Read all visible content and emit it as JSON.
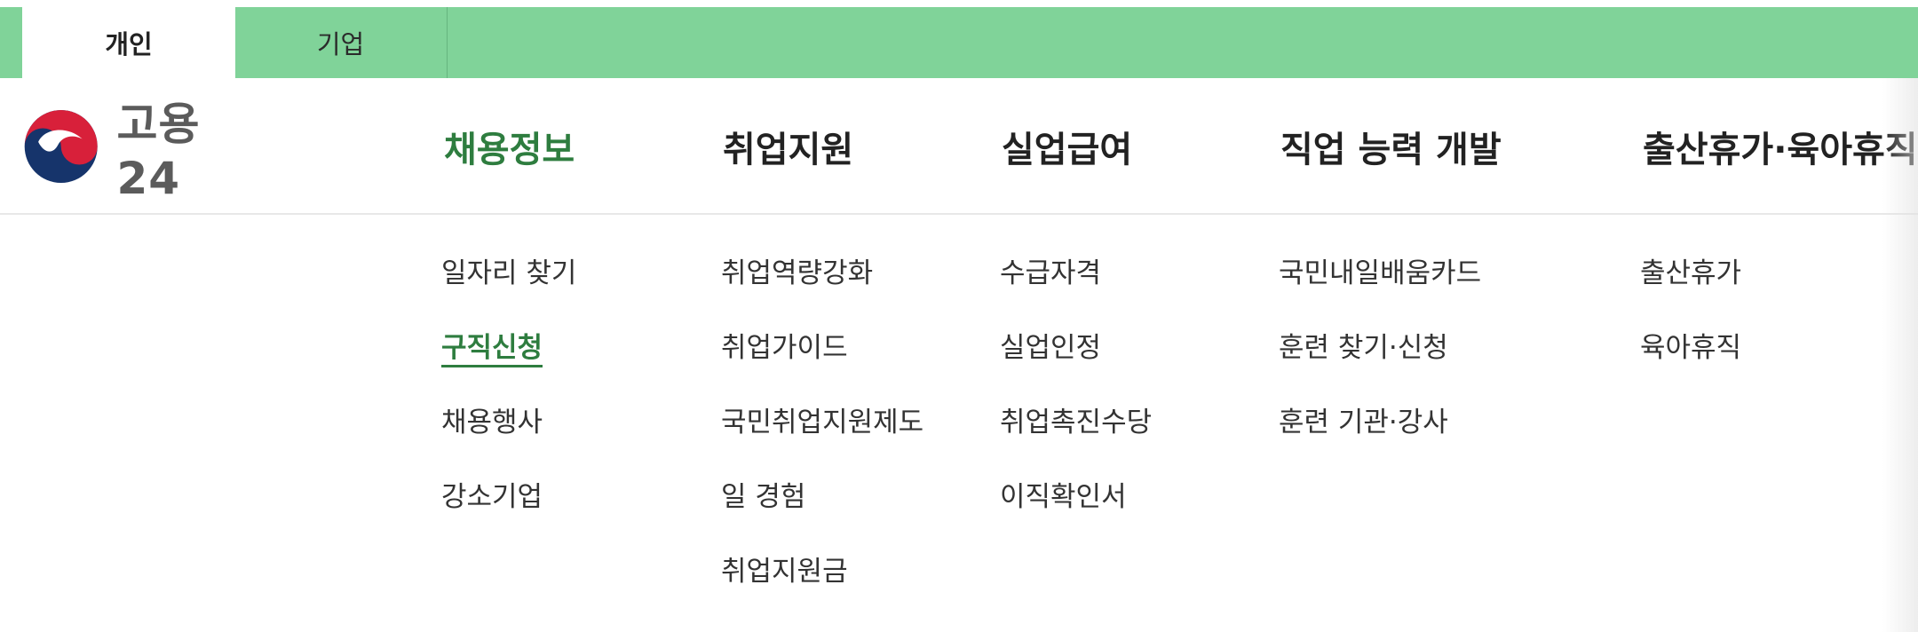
{
  "audience_tabs": [
    {
      "label": "개인",
      "active": true
    },
    {
      "label": "기업",
      "active": false
    }
  ],
  "logo": {
    "text": "고용24",
    "icon": "korea-government-emblem-icon"
  },
  "gnb": [
    {
      "label": "채용정보",
      "active": true
    },
    {
      "label": "취업지원",
      "active": false
    },
    {
      "label": "실업급여",
      "active": false
    },
    {
      "label": "직업 능력 개발",
      "active": false
    },
    {
      "label": "출산휴가·육아휴직",
      "active": false
    }
  ],
  "submenu": [
    {
      "items": [
        "일자리 찾기",
        "구직신청",
        "채용행사",
        "강소기업"
      ],
      "active_index": 1
    },
    {
      "items": [
        "취업역량강화",
        "취업가이드",
        "국민취업지원제도",
        "일 경험",
        "취업지원금"
      ]
    },
    {
      "items": [
        "수급자격",
        "실업인정",
        "취업촉진수당",
        "이직확인서"
      ]
    },
    {
      "items": [
        "국민내일배움카드",
        "훈련 찾기·신청",
        "훈련 기관·강사"
      ]
    },
    {
      "items": [
        "출산휴가",
        "육아휴직"
      ]
    }
  ],
  "colors": {
    "topbar": "#80d399",
    "accent": "#2e7d3f",
    "text": "#222222"
  }
}
